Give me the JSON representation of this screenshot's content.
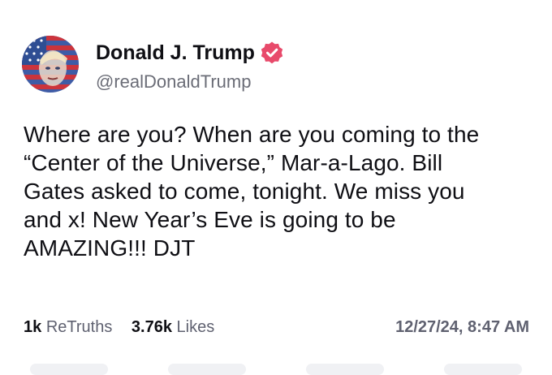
{
  "post": {
    "author": {
      "name": "Donald J. Trump",
      "handle": "@realDonaldTrump",
      "verified_color": "#e84a6b"
    },
    "text_lines": [
      "Where are you? When are you coming to the",
      "“Center of the Universe,” Mar-a-Lago. Bill",
      "Gates asked to come, tonight. We miss you",
      "and x! New Year’s Eve is going to be",
      "AMAZING!!! DJT"
    ],
    "stats": {
      "retruths_count": "1k",
      "retruths_label": "ReTruths",
      "likes_count": "3.76k",
      "likes_label": "Likes"
    },
    "timestamp": "12/27/24, 8:47 AM"
  },
  "icons": {
    "verified": "verified-badge-icon",
    "avatar": "flag-portrait-avatar"
  }
}
